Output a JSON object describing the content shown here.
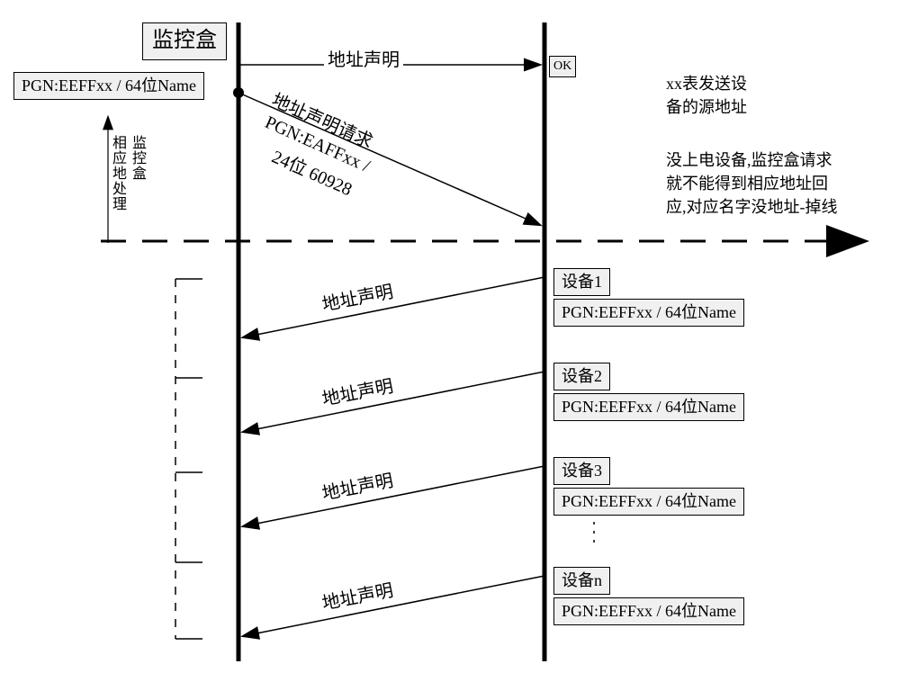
{
  "monitor": {
    "title": "监控盒",
    "pgn": "PGN:EEFFxx / 64位Name"
  },
  "ok_label": "OK",
  "arrows": {
    "addr_claim": "地址声明",
    "addr_claim_req_line1": "地址声明请求",
    "addr_claim_req_line2": "PGN:EAFFxx /",
    "addr_claim_req_line3": "24位 60928"
  },
  "devices": [
    {
      "title": "设备1",
      "pgn": "PGN:EEFFxx / 64位Name"
    },
    {
      "title": "设备2",
      "pgn": "PGN:EEFFxx / 64位Name"
    },
    {
      "title": "设备3",
      "pgn": "PGN:EEFFxx / 64位Name"
    },
    {
      "title": "设备n",
      "pgn": "PGN:EEFFxx / 64位Name"
    }
  ],
  "side_note": {
    "line1": "xx表发送设",
    "line2": "备的源地址",
    "line3": "没上电设备,监控盒请求",
    "line4": "就不能得到相应地址回",
    "line5": "应,对应名字没地址-掉线"
  },
  "vlabel": {
    "line1": "监控盒",
    "line2": "相应地处理"
  }
}
